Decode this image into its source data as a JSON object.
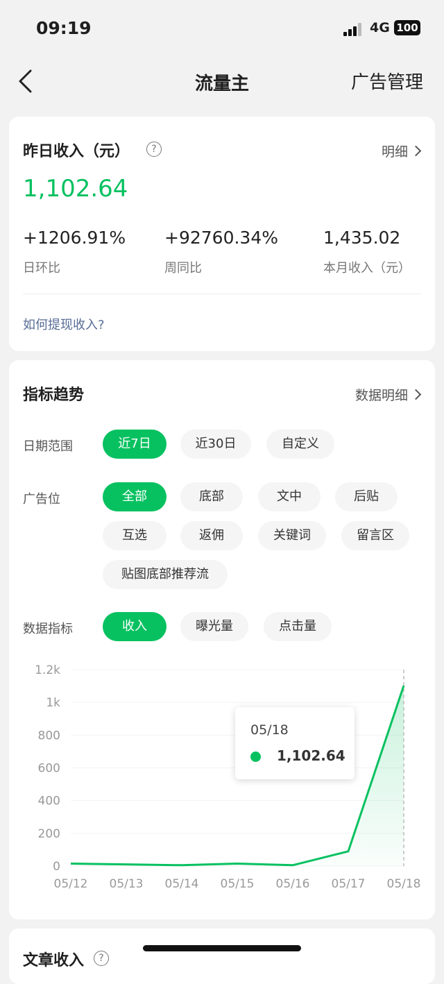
{
  "status_bar": {
    "time": "09:19",
    "network": "4G",
    "battery": "100"
  },
  "nav": {
    "title": "流量主",
    "right_link": "广告管理"
  },
  "income": {
    "title": "昨日收入（元）",
    "help_symbol": "?",
    "detail_link": "明细",
    "amount": "1,102.64",
    "stats": [
      {
        "value": "+1206.91%",
        "label": "日环比"
      },
      {
        "value": "+92760.34%",
        "label": "周同比"
      },
      {
        "value": "1,435.02",
        "label": "本月收入（元）"
      }
    ],
    "withdraw_link": "如何提现收入?"
  },
  "trend": {
    "title": "指标趋势",
    "detail_link": "数据明细",
    "date_range": {
      "label": "日期范围",
      "options": [
        "近7日",
        "近30日",
        "自定义"
      ],
      "selected": "近7日"
    },
    "ad_slot": {
      "label": "广告位",
      "options": [
        "全部",
        "底部",
        "文中",
        "后贴",
        "互选",
        "返佣",
        "关键词",
        "留言区",
        "贴图底部推荐流"
      ],
      "selected": "全部"
    },
    "metric": {
      "label": "数据指标",
      "options": [
        "收入",
        "曝光量",
        "点击量"
      ],
      "selected": "收入"
    }
  },
  "chart_data": {
    "type": "area",
    "x": [
      "05/12",
      "05/13",
      "05/14",
      "05/15",
      "05/16",
      "05/17",
      "05/18"
    ],
    "series": [
      {
        "values": [
          15,
          10,
          5,
          15,
          5,
          90,
          1102.64
        ]
      }
    ],
    "ylim": [
      0,
      1200
    ],
    "yticks": [
      "0",
      "200",
      "400",
      "600",
      "800",
      "1k",
      "1.2k"
    ],
    "tooltip": {
      "date": "05/18",
      "value": "1,102.64"
    },
    "colors": {
      "line": "#07c160"
    }
  },
  "article_income": {
    "title": "文章收入",
    "help_symbol": "?"
  }
}
